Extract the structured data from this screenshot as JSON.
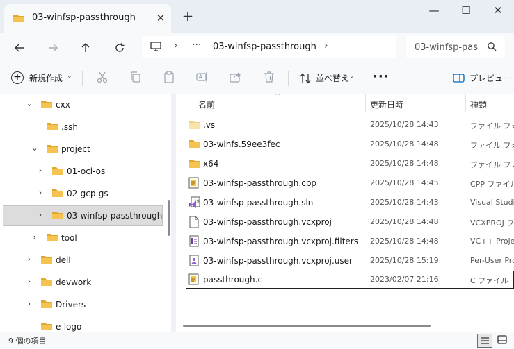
{
  "window": {
    "tab_title": "03-winfsp-passthrough",
    "add_tab": "+",
    "minimize": "—",
    "maximize": "☐",
    "close": "✕"
  },
  "address": {
    "overflow": "···",
    "breadcrumb": "03-winfsp-passthrough",
    "search_placeholder": "03-winfsp-pas"
  },
  "toolbar": {
    "new_label": "新規作成",
    "sort_label": "並べ替え",
    "more_label": "···",
    "preview_label": "プレビュー"
  },
  "tree": [
    {
      "label": "cxx",
      "depth": 0,
      "expanded": true,
      "has_children": true
    },
    {
      "label": ".ssh",
      "depth": 1,
      "expanded": false,
      "has_children": false
    },
    {
      "label": "project",
      "depth": 1,
      "expanded": true,
      "has_children": true
    },
    {
      "label": "01-oci-os",
      "depth": 2,
      "expanded": false,
      "has_children": true
    },
    {
      "label": "02-gcp-gs",
      "depth": 2,
      "expanded": false,
      "has_children": true
    },
    {
      "label": "03-winfsp-passthrough",
      "depth": 2,
      "expanded": false,
      "has_children": true,
      "selected": true
    },
    {
      "label": "tool",
      "depth": 1,
      "expanded": false,
      "has_children": true
    },
    {
      "label": "dell",
      "depth": 0,
      "expanded": false,
      "has_children": true
    },
    {
      "label": "devwork",
      "depth": 0,
      "expanded": false,
      "has_children": true
    },
    {
      "label": "Drivers",
      "depth": 0,
      "expanded": false,
      "has_children": true
    },
    {
      "label": "e-logo",
      "depth": 0,
      "expanded": false,
      "has_children": false
    }
  ],
  "columns": {
    "name": "名前",
    "date": "更新日時",
    "type": "種類"
  },
  "files": [
    {
      "name": ".vs",
      "date": "2025/10/28 14:43",
      "type": "ファイル フォルダー",
      "icon": "folder-icon"
    },
    {
      "name": "03-winfs.59ee3fec",
      "date": "2025/10/28 14:48",
      "type": "ファイル フォルダー",
      "icon": "folder-icon"
    },
    {
      "name": "x64",
      "date": "2025/10/28 14:48",
      "type": "ファイル フォルダー",
      "icon": "folder-icon"
    },
    {
      "name": "03-winfsp-passthrough.cpp",
      "date": "2025/10/28 14:45",
      "type": "CPP ファイル",
      "icon": "cpp-file-icon"
    },
    {
      "name": "03-winfsp-passthrough.sln",
      "date": "2025/10/28 14:43",
      "type": "Visual Studio",
      "icon": "visual-studio-solution-icon"
    },
    {
      "name": "03-winfsp-passthrough.vcxproj",
      "date": "2025/10/28 14:48",
      "type": "VCXPROJ ファイル",
      "icon": "blank-file-icon"
    },
    {
      "name": "03-winfsp-passthrough.vcxproj.filters",
      "date": "2025/10/28 14:48",
      "type": "VC++ Project",
      "icon": "filters-file-icon"
    },
    {
      "name": "03-winfsp-passthrough.vcxproj.user",
      "date": "2025/10/28 15:19",
      "type": "Per-User Proj",
      "icon": "user-file-icon"
    },
    {
      "name": "passthrough.c",
      "date": "2023/02/07 21:16",
      "type": "C ファイル",
      "icon": "c-file-icon",
      "focused": true
    }
  ],
  "status": {
    "item_count": "9 個の項目"
  },
  "colors": {
    "folder": "#f4c350",
    "folder_dark": "#e0a92e",
    "accent": "#0067c0",
    "selected_nav": "#dcdcdc"
  }
}
